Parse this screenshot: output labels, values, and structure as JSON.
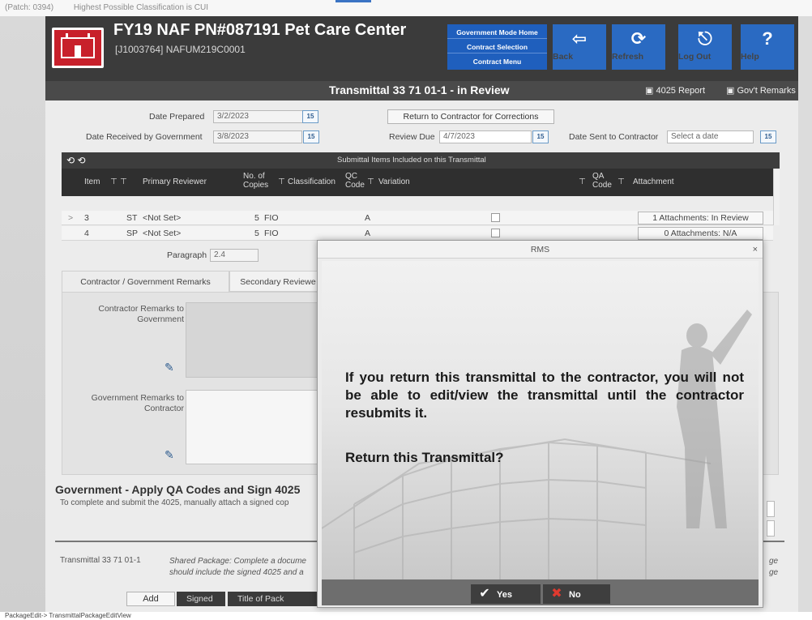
{
  "topstrip": {
    "patch": "(Patch: 0394)",
    "classification": "Highest Possible Classification is CUI"
  },
  "header": {
    "title": "FY19 NAF PN#087191 Pet Care Center",
    "subtitle": "[J1003764] NAFUM219C0001",
    "gov_menu": [
      "Government Mode Home",
      "Contract Selection",
      "Contract Menu"
    ],
    "buttons": [
      {
        "label": "Back",
        "icon": "back-arrow-icon"
      },
      {
        "label": "Refresh",
        "icon": "refresh-icon"
      },
      {
        "label": "Log Out",
        "icon": "logout-icon"
      },
      {
        "label": "Help",
        "icon": "help-icon"
      }
    ]
  },
  "title_bar": {
    "title": "Transmittal 33 71 01-1 - in Review",
    "report": "4025 Report",
    "remarks": "Gov't Remarks"
  },
  "form": {
    "date_prepared_label": "Date Prepared",
    "date_prepared": "3/2/2023",
    "date_received_label": "Date Received by Government",
    "date_received": "3/8/2023",
    "return_button": "Return to Contractor for Corrections",
    "review_due_label": "Review Due",
    "review_due": "4/7/2023",
    "date_sent_label": "Date Sent to Contractor",
    "date_sent_placeholder": "Select a date",
    "cal_label": "15"
  },
  "grid": {
    "title": "Submittal Items Included on this Transmittal",
    "columns": {
      "item": "Item",
      "primary_reviewer": "Primary Reviewer",
      "copies_1": "No. of",
      "copies_2": "Copies",
      "classification": "Classification",
      "qc_1": "QC",
      "qc_2": "Code",
      "variation": "Variation",
      "qa_1": "QA",
      "qa_2": "Code",
      "attachment": "Attachment"
    },
    "rows": [
      {
        "item": "3",
        "type": "ST",
        "reviewer": "<Not Set>",
        "copies": "5",
        "classification": "FIO",
        "qc": "A",
        "attachment": "1 Attachments: In Review"
      },
      {
        "item": "4",
        "type": "SP",
        "reviewer": "<Not Set>",
        "copies": "5",
        "classification": "FIO",
        "qc": "A",
        "attachment": "0 Attachments: N/A"
      }
    ],
    "paragraph_label": "Paragraph",
    "paragraph": "2.4"
  },
  "tabs": [
    "Contractor / Government Remarks",
    "Secondary Reviewe"
  ],
  "remarks": {
    "contractor_label": "Contractor Remarks to Government",
    "government_label": "Government Remarks to Contractor"
  },
  "qa_section": {
    "title": "Government - Apply QA Codes and Sign 4025",
    "subtitle": "To complete and submit the 4025, manually attach a signed cop"
  },
  "bottom": {
    "transmittal": "Transmittal 33 71 01-1",
    "shared_1": "Shared Package: Complete a docume",
    "shared_2": "should include the signed 4025 and a",
    "right_trunc": "ge",
    "right_trunc2": "ge",
    "add": "Add",
    "signed": "Signed",
    "title_of_pack": "Title of Pack"
  },
  "status_bar": "PackageEdit-> TransmittalPackageEditView",
  "modal": {
    "title": "RMS",
    "message": "If you return this transmittal to the contractor, you will not be able to edit/view the transmittal until the contractor resubmits it.",
    "question": "Return this Transmittal?",
    "yes": "Yes",
    "no": "No"
  }
}
